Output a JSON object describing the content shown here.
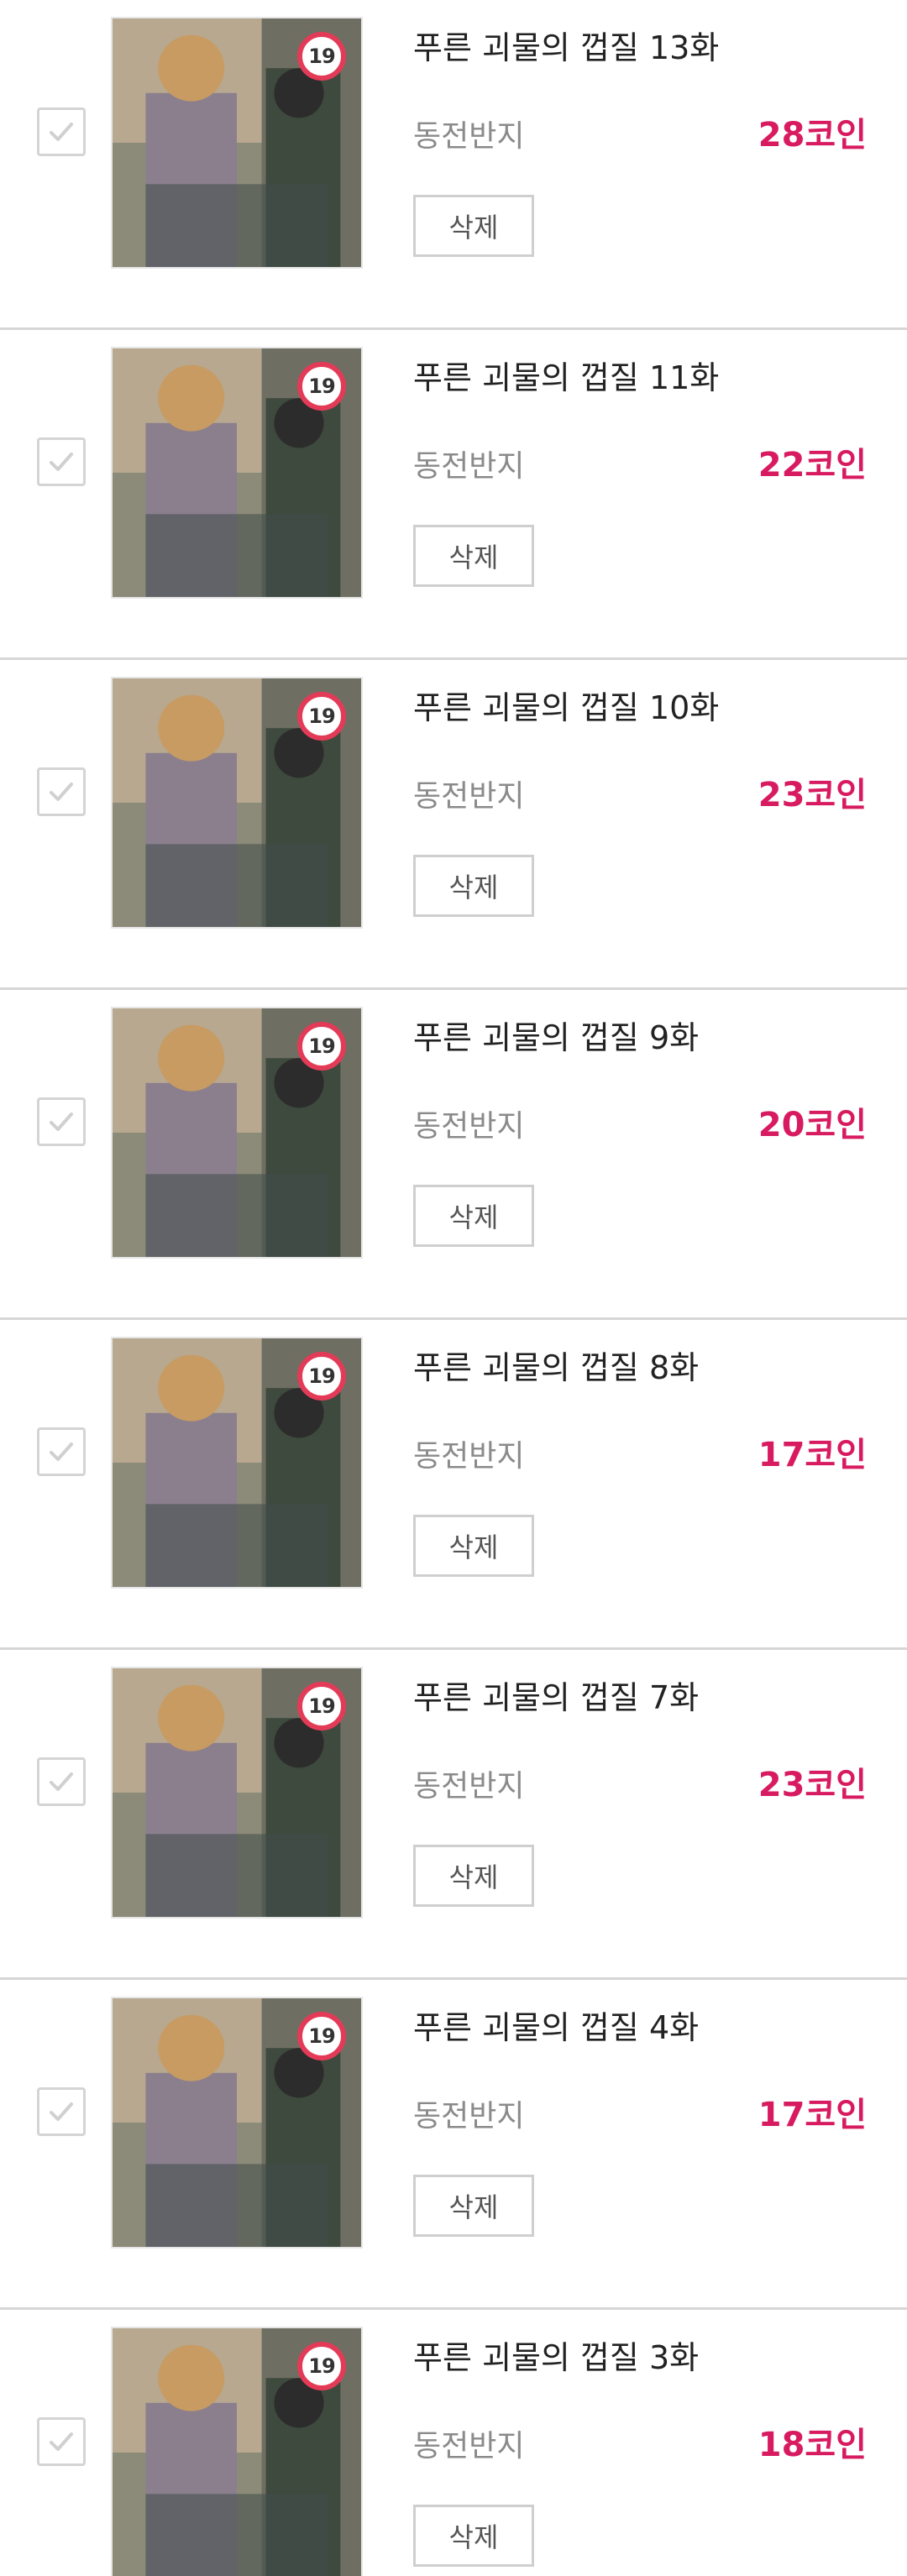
{
  "colors": {
    "price": "#d81b60",
    "badge_ring": "#e33b57",
    "divider": "#d6d6d6",
    "checkbox": "#d4d4d4"
  },
  "cart": {
    "items": [
      {
        "title": "푸른 괴물의 껍질 13화",
        "seller": "동전반지",
        "price": "28코인",
        "age_badge": "19",
        "delete_label": "삭제",
        "thumbnail_icon": "cover-art-icon",
        "checkbox_icon": "checkmark-icon"
      },
      {
        "title": "푸른 괴물의 껍질 11화",
        "seller": "동전반지",
        "price": "22코인",
        "age_badge": "19",
        "delete_label": "삭제",
        "thumbnail_icon": "cover-art-icon",
        "checkbox_icon": "checkmark-icon"
      },
      {
        "title": "푸른 괴물의 껍질 10화",
        "seller": "동전반지",
        "price": "23코인",
        "age_badge": "19",
        "delete_label": "삭제",
        "thumbnail_icon": "cover-art-icon",
        "checkbox_icon": "checkmark-icon"
      },
      {
        "title": "푸른 괴물의 껍질 9화",
        "seller": "동전반지",
        "price": "20코인",
        "age_badge": "19",
        "delete_label": "삭제",
        "thumbnail_icon": "cover-art-icon",
        "checkbox_icon": "checkmark-icon"
      },
      {
        "title": "푸른 괴물의 껍질 8화",
        "seller": "동전반지",
        "price": "17코인",
        "age_badge": "19",
        "delete_label": "삭제",
        "thumbnail_icon": "cover-art-icon",
        "checkbox_icon": "checkmark-icon"
      },
      {
        "title": "푸른 괴물의 껍질 7화",
        "seller": "동전반지",
        "price": "23코인",
        "age_badge": "19",
        "delete_label": "삭제",
        "thumbnail_icon": "cover-art-icon",
        "checkbox_icon": "checkmark-icon"
      },
      {
        "title": "푸른 괴물의 껍질 4화",
        "seller": "동전반지",
        "price": "17코인",
        "age_badge": "19",
        "delete_label": "삭제",
        "thumbnail_icon": "cover-art-icon",
        "checkbox_icon": "checkmark-icon"
      },
      {
        "title": "푸른 괴물의 껍질 3화",
        "seller": "동전반지",
        "price": "18코인",
        "age_badge": "19",
        "delete_label": "삭제",
        "thumbnail_icon": "cover-art-icon",
        "checkbox_icon": "checkmark-icon"
      }
    ]
  }
}
